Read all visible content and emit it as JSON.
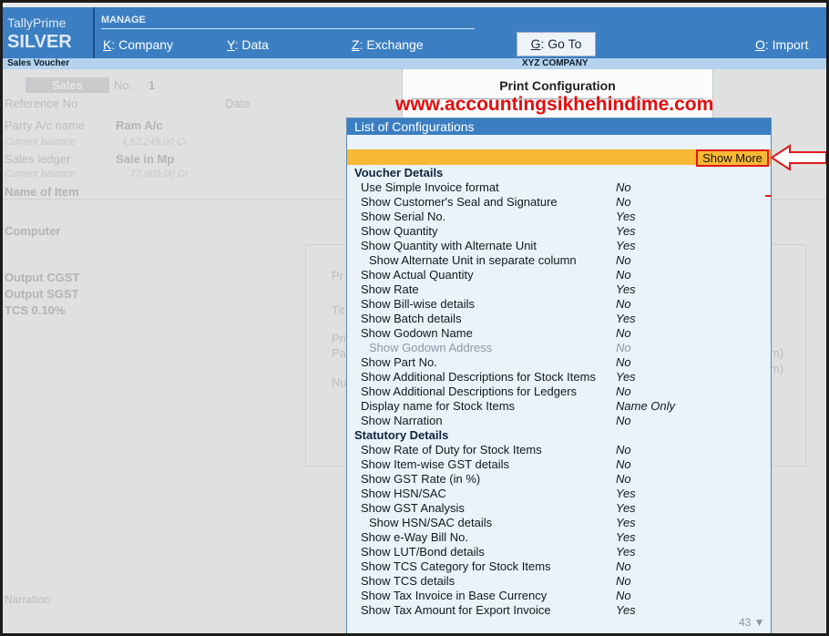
{
  "header": {
    "brand_line1": "TallyPrime",
    "brand_line2": "SILVER",
    "manage": "MANAGE",
    "menu": [
      {
        "key": "K",
        "label": ": Company"
      },
      {
        "key": "Y",
        "label": ": Data"
      },
      {
        "key": "Z",
        "label": ": Exchange"
      },
      {
        "key": "G",
        "label": ": Go To"
      },
      {
        "key": "O",
        "label": ": Import"
      }
    ]
  },
  "subbar": {
    "left": "Sales Voucher",
    "center": "XYZ COMPANY"
  },
  "voucher": {
    "type": "Sales",
    "no_label": "No.",
    "no_value": "1",
    "reference_no": "Reference No",
    "date": "Date",
    "party_label": "Party A/c name",
    "party_value": "Ram A/c",
    "party_balance_label": "Current balance",
    "party_balance_value": "4,82,249.00 Cr",
    "sales_ledger_label": "Sales ledger",
    "sales_ledger_value": "Sale in Mp",
    "sales_balance_label": "Current balance",
    "sales_balance_value": "77,009.00 Cr",
    "item_header": "Name of Item",
    "item": "Computer",
    "taxes": [
      "Output CGST",
      "Output SGST",
      "TCS 0.10%"
    ],
    "panel_fragments": [
      "Pr",
      "Tit",
      "Pri",
      "Pa",
      "Nu",
      "m)",
      "m)"
    ],
    "narration": "Narration:"
  },
  "print_config": {
    "title": "Print Configuration"
  },
  "watermark": "www.accountingsikhehindime.com",
  "list": {
    "title": "List of Configurations",
    "show_more": "Show More",
    "page_count": "43 ▼",
    "rows": [
      {
        "label": "Voucher Details",
        "value": "",
        "section": true
      },
      {
        "label": "Use Simple Invoice format",
        "value": "No"
      },
      {
        "label": "Show Customer's Seal and Signature",
        "value": "No"
      },
      {
        "label": "Show Serial No.",
        "value": "Yes"
      },
      {
        "label": "Show Quantity",
        "value": "Yes"
      },
      {
        "label": "Show Quantity with Alternate Unit",
        "value": "Yes"
      },
      {
        "label": "Show Alternate Unit in separate column",
        "value": "No",
        "indent": true
      },
      {
        "label": "Show Actual Quantity",
        "value": "No"
      },
      {
        "label": "Show Rate",
        "value": "Yes"
      },
      {
        "label": "Show Bill-wise details",
        "value": "No"
      },
      {
        "label": "Show Batch details",
        "value": "Yes"
      },
      {
        "label": "Show Godown Name",
        "value": "No"
      },
      {
        "label": "Show Godown Address",
        "value": "No",
        "indent": true,
        "dim": true
      },
      {
        "label": "Show Part No.",
        "value": "No"
      },
      {
        "label": "Show Additional Descriptions for Stock Items",
        "value": "Yes"
      },
      {
        "label": "Show Additional Descriptions for Ledgers",
        "value": "No"
      },
      {
        "label": "Display name for Stock Items",
        "value": "Name Only"
      },
      {
        "label": "Show Narration",
        "value": "No"
      },
      {
        "label": "Statutory Details",
        "value": "",
        "section": true
      },
      {
        "label": "Show Rate of Duty for Stock Items",
        "value": "No"
      },
      {
        "label": "Show Item-wise GST details",
        "value": "No"
      },
      {
        "label": "Show GST Rate (in %)",
        "value": "No"
      },
      {
        "label": "Show HSN/SAC",
        "value": "Yes"
      },
      {
        "label": "Show GST Analysis",
        "value": "Yes"
      },
      {
        "label": "Show HSN/SAC details",
        "value": "Yes",
        "indent": true
      },
      {
        "label": "Show e-Way Bill No.",
        "value": "Yes"
      },
      {
        "label": "Show LUT/Bond details",
        "value": "Yes"
      },
      {
        "label": "Show TCS Category for Stock Items",
        "value": "No"
      },
      {
        "label": "Show TCS details",
        "value": "No"
      },
      {
        "label": "Show Tax Invoice in Base Currency",
        "value": "No"
      },
      {
        "label": "Show Tax Amount for Export Invoice",
        "value": "Yes"
      }
    ]
  }
}
